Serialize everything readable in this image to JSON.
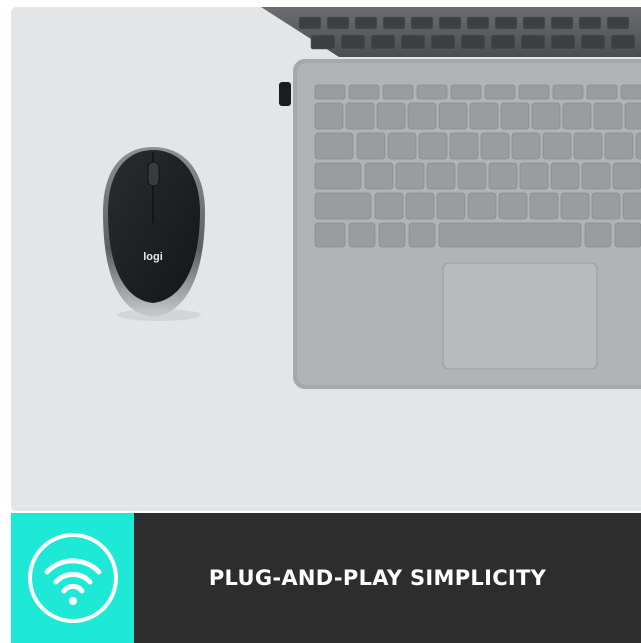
{
  "product": {
    "logo_text": "logi"
  },
  "banner": {
    "icon": "wifi-icon",
    "caption": "PLUG-AND-PLAY SIMPLICITY",
    "badge_color": "#1de9d6",
    "caption_bg": "#2d2d2d"
  }
}
